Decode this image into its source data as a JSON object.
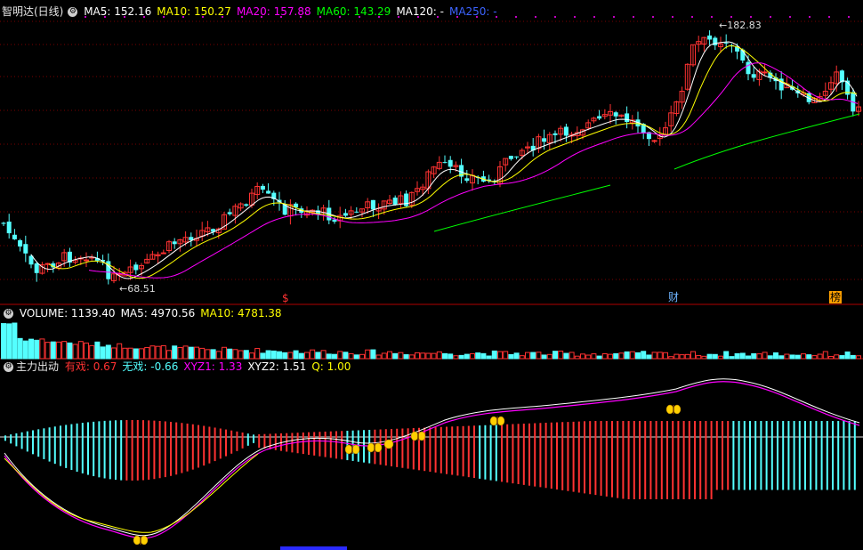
{
  "colors": {
    "bg": "#000000",
    "up": "#ff3232",
    "down": "#54ffff",
    "ma5": "#ffffff",
    "ma10": "#ffff00",
    "ma20": "#ff00ff",
    "ma60": "#00ff00",
    "ma120": "#ffffff",
    "ma250": "#3c64ff",
    "grid": "#7a0000",
    "divider": "#b00000"
  },
  "price_panel": {
    "title": "智明达(日线)",
    "indicators": [
      {
        "label": "MA5: ",
        "value": "152.16",
        "color": "#ffffff"
      },
      {
        "label": "MA10: ",
        "value": "150.27",
        "color": "#ffff00"
      },
      {
        "label": "MA20: ",
        "value": "157.88",
        "color": "#ff00ff"
      },
      {
        "label": "MA60: ",
        "value": "143.29",
        "color": "#00ff00"
      },
      {
        "label": "MA120: ",
        "value": "-",
        "color": "#ffffff"
      },
      {
        "label": "MA250: ",
        "value": "-",
        "color": "#3c64ff"
      }
    ],
    "high_label": "182.83",
    "low_label": "68.51",
    "markers": [
      {
        "text": "$",
        "color": "#ff3232",
        "kind": "s"
      },
      {
        "text": "财",
        "color": "#6fb4ff",
        "kind": "cai"
      },
      {
        "text": "榜",
        "color": "#ffa000",
        "kind": "bang"
      }
    ]
  },
  "volume_panel": {
    "indicators": [
      {
        "label": "VOLUME: ",
        "value": "1139.40",
        "color": "#ffffff"
      },
      {
        "label": "MA5: ",
        "value": "4970.56",
        "color": "#ffffff"
      },
      {
        "label": "MA10: ",
        "value": "4781.38",
        "color": "#ffff00"
      }
    ]
  },
  "indicator_panel": {
    "title": "主力出动",
    "indicators": [
      {
        "label": "有戏: ",
        "value": "0.67",
        "color": "#ff3232"
      },
      {
        "label": "无戏: ",
        "value": "-0.66",
        "color": "#54ffff"
      },
      {
        "label": "XYZ1: ",
        "value": "1.33",
        "color": "#ff00ff"
      },
      {
        "label": "XYZ2: ",
        "value": "1.51",
        "color": "#ffffff"
      },
      {
        "label": "Q: ",
        "value": "1.00",
        "color": "#ffff00"
      }
    ]
  }
}
